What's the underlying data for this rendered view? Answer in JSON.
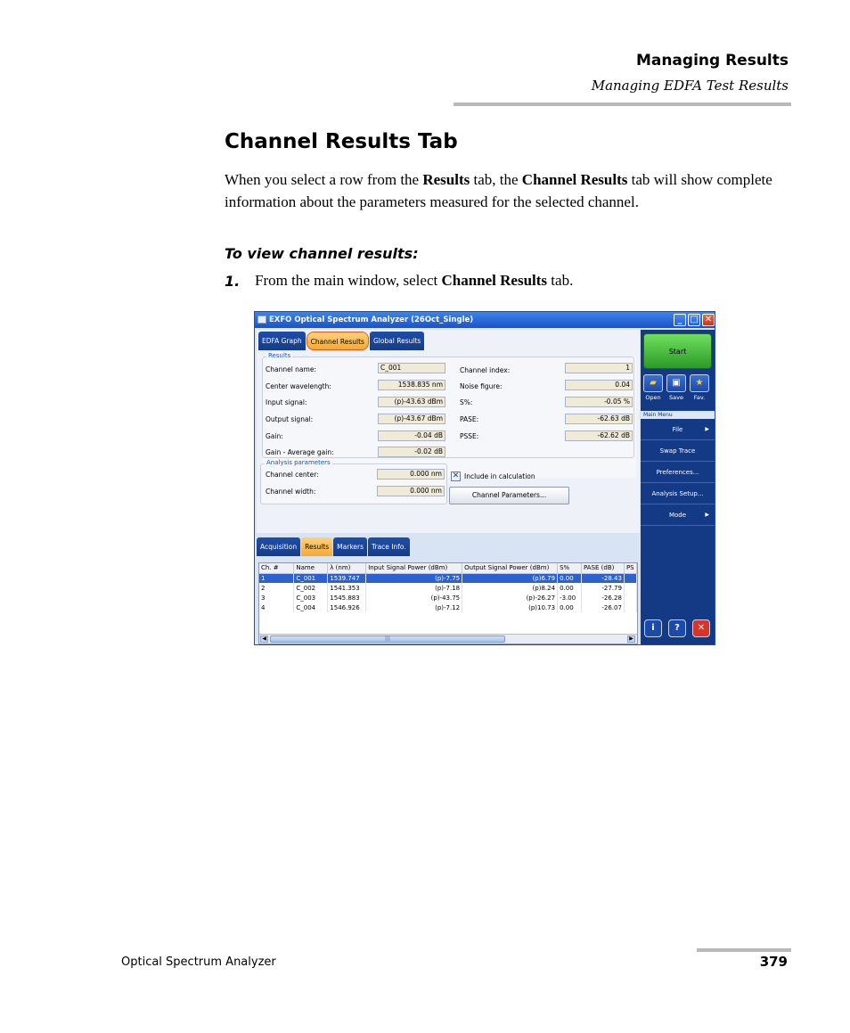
{
  "page": {
    "header_title": "Managing Results",
    "header_subtitle": "Managing EDFA Test Results",
    "section_title": "Channel Results Tab",
    "para_p1": "When you select a row from the ",
    "para_b1": "Results",
    "para_p2": " tab, the ",
    "para_b2": "Channel Results",
    "para_p3": " tab will show complete information about the parameters measured for the selected channel.",
    "procedure_title": "To view channel results:",
    "step_number": "1.",
    "step_p1": "From the main window, select ",
    "step_b1": "Channel Results",
    "step_p2": " tab.",
    "footer_left": "Optical Spectrum Analyzer",
    "footer_page": "379"
  },
  "app": {
    "title": "EXFO Optical Spectrum Analyzer (26Oct_Single)",
    "tabs": [
      "EDFA Graph",
      "Channel Results",
      "Global Results"
    ],
    "results_group": "Results",
    "channel_name_label": "Channel name:",
    "channel_name_value": "C_001",
    "center_wl_label": "Center wavelength:",
    "center_wl_value": "1538.835 nm",
    "input_signal_label": "Input signal:",
    "input_signal_value": "(p)-43.63 dBm",
    "output_signal_label": "Output signal:",
    "output_signal_value": "(p)-43.67 dBm",
    "gain_label": "Gain:",
    "gain_value": "-0.04 dB",
    "gain_avg_label": "Gain - Average gain:",
    "gain_avg_value": "-0.02 dB",
    "channel_index_label": "Channel index:",
    "channel_index_value": "1",
    "noise_figure_label": "Noise figure:",
    "noise_figure_value": "0.04",
    "s_pct_label": "S%:",
    "s_pct_value": "-0.05 %",
    "pase_label": "PASE:",
    "pase_value": "-62.63 dB",
    "psse_label": "PSSE:",
    "psse_value": "-62.62 dB",
    "analysis_group": "Analysis parameters",
    "channel_center_label": "Channel center:",
    "channel_center_value": "0.000 nm",
    "channel_width_label": "Channel width:",
    "channel_width_value": "0.000 nm",
    "include_label": "Include in calculation",
    "channel_params_button": "Channel Parameters...",
    "bottom_tabs": [
      "Acquisition",
      "Results",
      "Markers",
      "Trace Info."
    ],
    "table_headers": [
      "Ch. #",
      "Name",
      "λ (nm)",
      "Input Signal Power (dBm)",
      "Output Signal Power (dBm)",
      "S%",
      "PASE (dB)",
      "PS"
    ],
    "table_rows": [
      [
        "1",
        "C_001",
        "1539.747",
        "(p)-7.75",
        "(p)6.79",
        "0.00",
        "-28.43"
      ],
      [
        "2",
        "C_002",
        "1541.353",
        "(p)-7.18",
        "(p)8.24",
        "0.00",
        "-27.79"
      ],
      [
        "3",
        "C_003",
        "1545.883",
        "(p)-43.75",
        "(p)-26.27",
        "-3.00",
        "-26.28"
      ],
      [
        "4",
        "C_004",
        "1546.926",
        "(p)-7.12",
        "(p)10.73",
        "0.00",
        "-26.07"
      ]
    ],
    "start_label": "Start",
    "quick_buttons": [
      "Open",
      "Save",
      "Fav."
    ],
    "main_menu_label": "Main Menu",
    "menu_items": [
      "File",
      "Swap Trace",
      "Preferences...",
      "Analysis Setup...",
      "Mode"
    ]
  }
}
